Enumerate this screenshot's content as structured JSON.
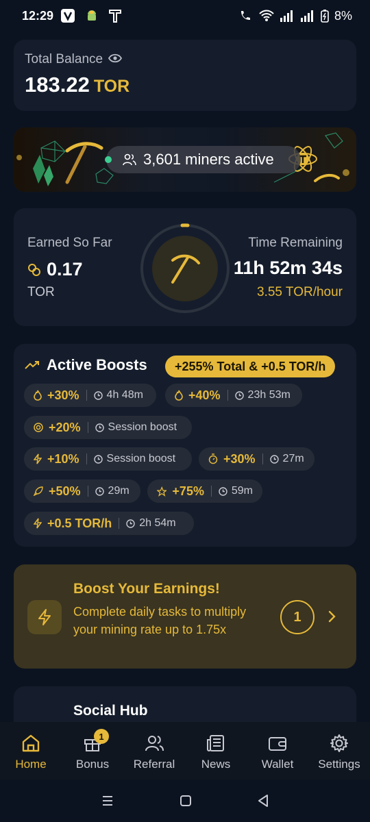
{
  "status_bar": {
    "time": "12:29",
    "battery": "8%"
  },
  "balance": {
    "label": "Total Balance",
    "amount": "183.22",
    "unit": "TOR"
  },
  "banner": {
    "miners_text": "3,601 miners active"
  },
  "mining": {
    "earned_label": "Earned So Far",
    "earned_value": "0.17",
    "earned_unit": "TOR",
    "time_label": "Time Remaining",
    "time_value": "11h 52m 34s",
    "rate": "3.55 TOR/hour"
  },
  "boosts": {
    "title": "Active Boosts",
    "total": "+255% Total & +0.5 TOR/h",
    "items": [
      {
        "icon": "flame-icon",
        "value": "+30%",
        "duration": "4h 48m"
      },
      {
        "icon": "flame-icon",
        "value": "+40%",
        "duration": "23h 53m"
      },
      {
        "icon": "target-icon",
        "value": "+20%",
        "duration": "Session boost"
      },
      {
        "icon": "bolt-icon",
        "value": "+10%",
        "duration": "Session boost"
      },
      {
        "icon": "stopwatch-icon",
        "value": "+30%",
        "duration": "27m"
      },
      {
        "icon": "rocket-icon",
        "value": "+50%",
        "duration": "29m"
      },
      {
        "icon": "star-icon",
        "value": "+75%",
        "duration": "59m"
      },
      {
        "icon": "bolt-icon",
        "value": "+0.5 TOR/h",
        "duration": "2h 54m"
      }
    ]
  },
  "promo": {
    "title": "Boost Your Earnings!",
    "text": "Complete daily tasks to multiply your mining rate up to 1.75x",
    "count": "1"
  },
  "social": {
    "title": "Social Hub"
  },
  "nav": {
    "items": [
      {
        "label": "Home",
        "icon": "home-icon"
      },
      {
        "label": "Bonus",
        "icon": "gift-icon",
        "badge": "1"
      },
      {
        "label": "Referral",
        "icon": "users-icon"
      },
      {
        "label": "News",
        "icon": "newspaper-icon"
      },
      {
        "label": "Wallet",
        "icon": "wallet-icon"
      },
      {
        "label": "Settings",
        "icon": "gear-icon"
      }
    ]
  },
  "colors": {
    "accent": "#e6b93a",
    "background": "#0c1320",
    "card": "#151d2c"
  }
}
